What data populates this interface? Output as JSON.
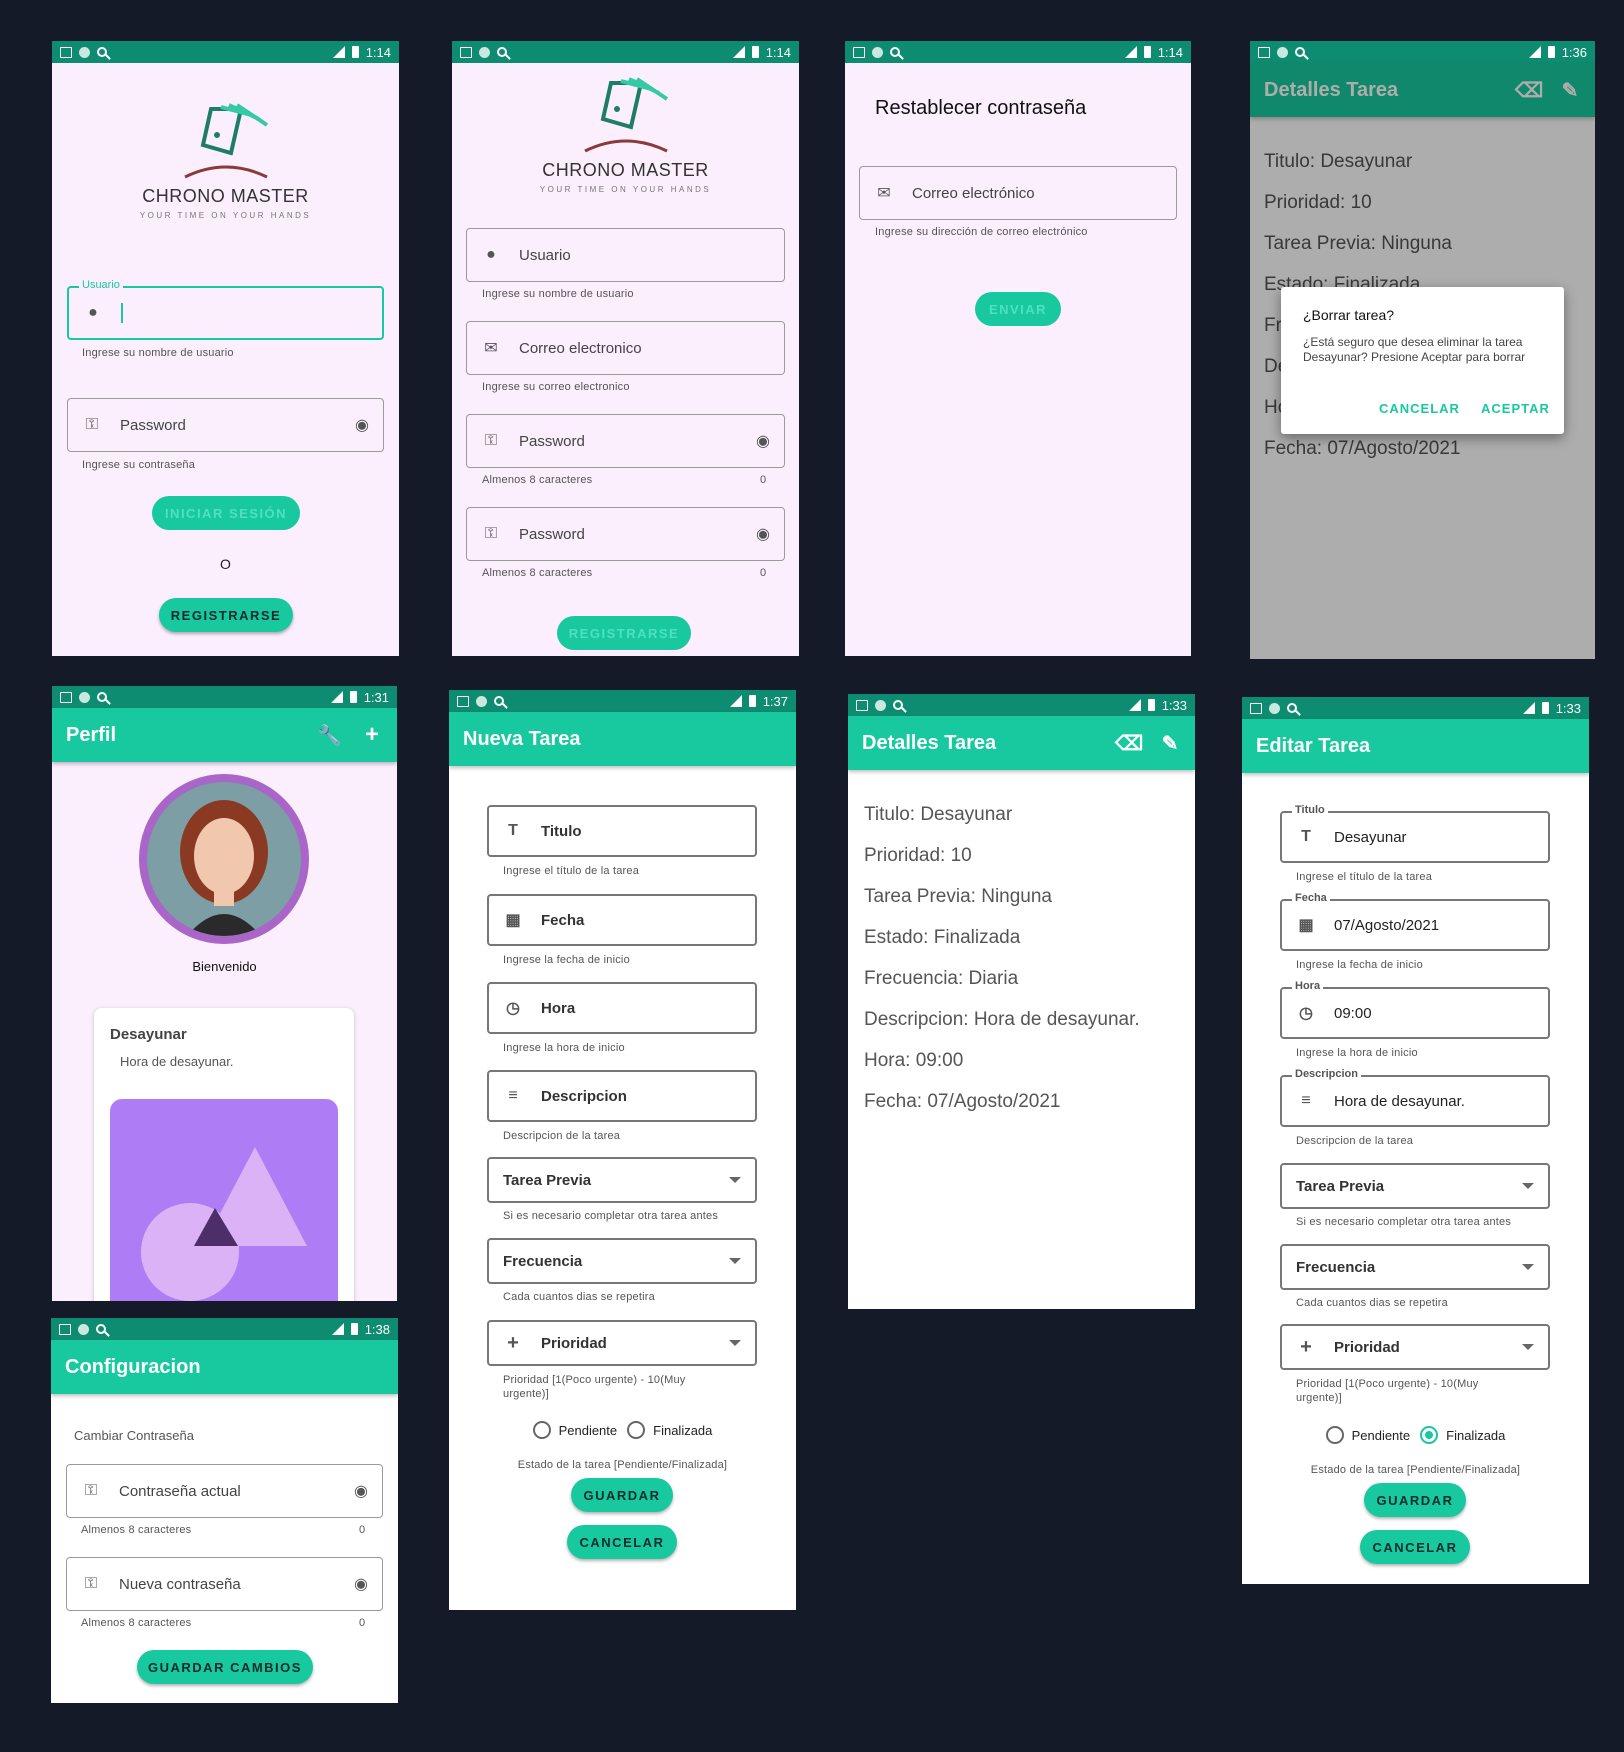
{
  "app": {
    "name": "CHRONO MASTER",
    "tagline": "YOUR TIME ON YOUR HANDS"
  },
  "status_times": {
    "login": "1:14",
    "register": "1:14",
    "reset": "1:14",
    "delete": "1:36",
    "profile": "1:31",
    "new_task": "1:37",
    "details": "1:33",
    "edit": "1:33",
    "config": "1:38"
  },
  "login": {
    "user_label": "Usuario",
    "user_help": "Ingrese su nombre de usuario",
    "password_placeholder": "Password",
    "password_help": "Ingrese su contraseña",
    "login_button": "INICIAR SESIÓN",
    "separator": "O",
    "register_button": "REGISTRARSE"
  },
  "register": {
    "user_placeholder": "Usuario",
    "user_help": "Ingrese su nombre de usuario",
    "email_placeholder": "Correo electronico",
    "email_help": "Ingrese su correo electronico",
    "password_placeholder": "Password",
    "password_help": "Almenos 8 caracteres",
    "password_count": "0",
    "password2_placeholder": "Password",
    "password2_help": "Almenos 8 caracteres",
    "password2_count": "0",
    "register_button": "REGISTRARSE"
  },
  "reset": {
    "title": "Restablecer contraseña",
    "email_placeholder": "Correo electrónico",
    "email_help": "Ingrese su dirección de correo electrónico",
    "send_button": "ENVIAR"
  },
  "delete_dialog": {
    "appbar_title": "Detalles Tarea",
    "bg_lines": [
      "Titulo: Desayunar",
      "Prioridad: 10",
      "Tarea Previa: Ninguna",
      "Estado: Finalizada",
      "Fr",
      "De",
      "Ho",
      "Fecha: 07/Agosto/2021"
    ],
    "title": "¿Borrar tarea?",
    "message": "¿Está seguro que desea eliminar la tarea Desayunar? Presione Aceptar para borrar",
    "cancel": "CANCELAR",
    "accept": "ACEPTAR"
  },
  "profile": {
    "title": "Perfil",
    "welcome": "Bienvenido",
    "card_title": "Desayunar",
    "card_subtitle": "Hora de desayunar."
  },
  "new_task": {
    "title": "Nueva Tarea",
    "title_field": "Titulo",
    "title_help": "Ingrese el título de la tarea",
    "date_field": "Fecha",
    "date_help": "Ingrese la fecha de inicio",
    "time_field": "Hora",
    "time_help": "Ingrese la hora de inicio",
    "desc_field": "Descripcion",
    "desc_help": "Descripcion de la tarea",
    "prev_field": "Tarea Previa",
    "prev_help": "Si es necesario completar otra tarea antes",
    "freq_field": "Frecuencia",
    "freq_help": "Cada cuantos dias se repetira",
    "prio_field": "Prioridad",
    "prio_help": "Prioridad [1(Poco urgente) - 10(Muy urgente)]",
    "opt_pending": "Pendiente",
    "opt_done": "Finalizada",
    "status_help": "Estado de la tarea [Pendiente/Finalizada]",
    "save": "GUARDAR",
    "cancel": "CANCELAR"
  },
  "details": {
    "title": "Detalles Tarea",
    "lines": [
      "Titulo: Desayunar",
      "Prioridad: 10",
      "Tarea Previa: Ninguna",
      "Estado: Finalizada",
      "Frecuencia: Diaria",
      "Descripcion: Hora de desayunar.",
      "Hora: 09:00",
      "Fecha: 07/Agosto/2021"
    ]
  },
  "edit": {
    "title": "Editar Tarea",
    "title_label": "Titulo",
    "title_value": "Desayunar",
    "title_help": "Ingrese el título de la tarea",
    "date_label": "Fecha",
    "date_value": "07/Agosto/2021",
    "date_help": "Ingrese la fecha de inicio",
    "time_label": "Hora",
    "time_value": "09:00",
    "time_help": "Ingrese la hora de inicio",
    "desc_label": "Descripcion",
    "desc_value": "Hora de desayunar.",
    "desc_help": "Descripcion de la tarea",
    "prev_field": "Tarea Previa",
    "prev_help": "Si es necesario completar otra tarea antes",
    "freq_field": "Frecuencia",
    "freq_help": "Cada cuantos dias se repetira",
    "prio_field": "Prioridad",
    "prio_help": "Prioridad [1(Poco urgente) - 10(Muy urgente)]",
    "opt_pending": "Pendiente",
    "opt_done": "Finalizada",
    "status_help": "Estado de la tarea [Pendiente/Finalizada]",
    "save": "GUARDAR",
    "cancel": "CANCELAR"
  },
  "config": {
    "title": "Configuracion",
    "section": "Cambiar Contraseña",
    "current_placeholder": "Contraseña actual",
    "current_help": "Almenos 8 caracteres",
    "current_count": "0",
    "new_placeholder": "Nueva contraseña",
    "new_help": "Almenos 8 caracteres",
    "new_count": "0",
    "save_button": "GUARDAR CAMBIOS"
  },
  "colors": {
    "primary": "#18c9a0",
    "status_bar": "#0e8c71",
    "background": "#141a27",
    "screen_pink": "#fbeefd",
    "avatar_ring": "#a965c8"
  }
}
